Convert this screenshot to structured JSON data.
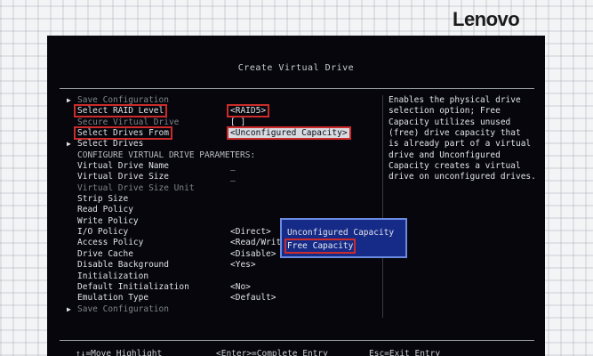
{
  "brand": {
    "logo_text": "Lenovo"
  },
  "screen": {
    "title": "Create Virtual Drive",
    "rows": [
      {
        "arrow": "▶",
        "label": "Save Configuration",
        "value": "",
        "style": "dim"
      },
      {
        "arrow": "",
        "label": "Select RAID Level",
        "value": "<RAID5>",
        "style": "normal",
        "boxed": true
      },
      {
        "arrow": "",
        "label": "Secure Virtual Drive",
        "value": "[ ]",
        "style": "dim"
      },
      {
        "arrow": "",
        "label": "Select Drives From",
        "value": "<Unconfigured Capacity>",
        "style": "normal",
        "boxed": true,
        "highlight": true
      },
      {
        "arrow": "▶",
        "label": "Select Drives",
        "value": "",
        "style": "normal"
      },
      {
        "arrow": "",
        "label": "CONFIGURE VIRTUAL DRIVE PARAMETERS:",
        "value": "",
        "style": "heading"
      },
      {
        "arrow": "",
        "label": "Virtual Drive Name",
        "value": "_",
        "style": "normal"
      },
      {
        "arrow": "",
        "label": "Virtual Drive Size",
        "value": "_",
        "style": "normal"
      },
      {
        "arrow": "",
        "label": "Virtual Drive Size Unit",
        "value": "",
        "style": "dim"
      },
      {
        "arrow": "",
        "label": "Strip Size",
        "value": "",
        "style": "normal"
      },
      {
        "arrow": "",
        "label": "Read Policy",
        "value": "",
        "style": "normal"
      },
      {
        "arrow": "",
        "label": "Write Policy",
        "value": "",
        "style": "normal"
      },
      {
        "arrow": "",
        "label": "I/O Policy",
        "value": "<Direct>",
        "style": "normal"
      },
      {
        "arrow": "",
        "label": "Access Policy",
        "value": "<Read/Write>",
        "style": "normal"
      },
      {
        "arrow": "",
        "label": "Drive Cache",
        "value": "<Disable>",
        "style": "normal"
      },
      {
        "arrow": "",
        "label": "Disable Background",
        "value": "<Yes>",
        "style": "normal"
      },
      {
        "arrow": "",
        "label": "Initialization",
        "value": "",
        "style": "normal"
      },
      {
        "arrow": "",
        "label": "Default Initialization",
        "value": "<No>",
        "style": "normal"
      },
      {
        "arrow": "",
        "label": "Emulation Type",
        "value": "<Default>",
        "style": "normal"
      },
      {
        "arrow": "▶",
        "label": "Save Configuration",
        "value": "",
        "style": "dim"
      }
    ],
    "help_lines": [
      "Enables the physical drive",
      "selection option; Free",
      "Capacity utilizes unused",
      "(free) drive capacity that",
      "is already part of a virtual",
      "drive and Unconfigured",
      "Capacity creates a virtual",
      "drive on unconfigured drives."
    ],
    "popup": {
      "options": [
        "Unconfigured Capacity",
        "Free Capacity"
      ],
      "selected_index": 1
    },
    "footer": {
      "left": "↑↓=Move Highlight",
      "middle": "<Enter>=Complete Entry",
      "right": "Esc=Exit Entry"
    }
  }
}
